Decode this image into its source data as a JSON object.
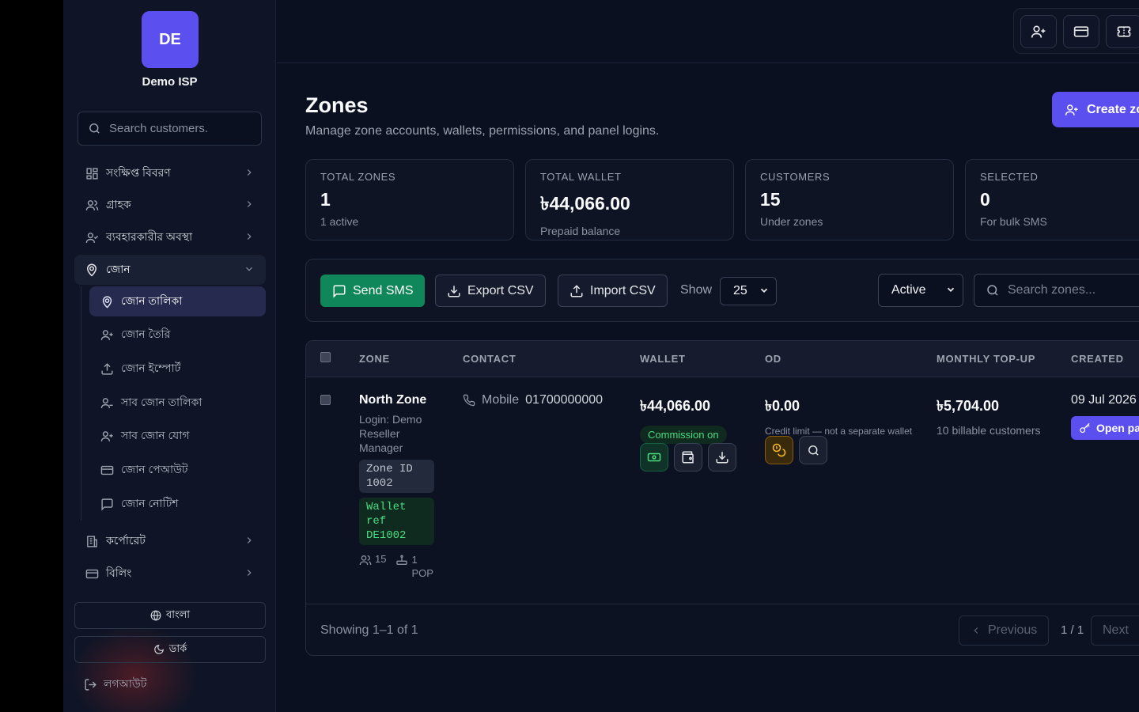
{
  "sidebar": {
    "brand_initials": "DE",
    "brand_name": "Demo ISP",
    "search_placeholder": "Search customers.",
    "nav": [
      {
        "label": "সংক্ষিপ্ত বিবরণ",
        "icon": "dashboard-icon"
      },
      {
        "label": "গ্রাহক",
        "icon": "users-icon"
      },
      {
        "label": "ব্যবহারকারীর অবস্থা",
        "icon": "user-status-icon"
      },
      {
        "label": "জোন",
        "icon": "map-pin-icon"
      }
    ],
    "sub_nav": [
      {
        "label": "জোন তালিকা",
        "icon": "map-pin-icon"
      },
      {
        "label": "জোন তৈরি",
        "icon": "user-plus-icon"
      },
      {
        "label": "জোন ইম্পোর্ট",
        "icon": "upload-icon"
      },
      {
        "label": "সাব জোন তালিকা",
        "icon": "user-icon"
      },
      {
        "label": "সাব জোন যোগ",
        "icon": "user-plus-icon"
      },
      {
        "label": "জোন পেআউট",
        "icon": "credit-card-icon"
      },
      {
        "label": "জোন নোটিশ",
        "icon": "message-icon"
      }
    ],
    "nav_bottom": [
      {
        "label": "কর্পোরেট",
        "icon": "building-icon"
      },
      {
        "label": "বিলিং",
        "icon": "credit-card-icon"
      }
    ],
    "language_button": "বাংলা",
    "theme_button": "ডার্ক",
    "logout": "লগআউট"
  },
  "page": {
    "title": "Zones",
    "subtitle": "Manage zone accounts, wallets, permissions, and panel logins.",
    "create_button": "Create zone"
  },
  "stats": [
    {
      "label": "TOTAL ZONES",
      "value": "1",
      "note": "1 active"
    },
    {
      "label": "TOTAL WALLET",
      "value": "৳44,066.00",
      "note": "Prepaid balance"
    },
    {
      "label": "CUSTOMERS",
      "value": "15",
      "note": "Under zones"
    },
    {
      "label": "SELECTED",
      "value": "0",
      "note": "For bulk SMS"
    }
  ],
  "toolbar": {
    "send_sms": "Send SMS",
    "export_csv": "Export CSV",
    "import_csv": "Import CSV",
    "show_label": "Show",
    "page_size": "25",
    "status_filter": "Active",
    "search_placeholder": "Search zones..."
  },
  "table": {
    "headers": [
      "ZONE",
      "CONTACT",
      "WALLET",
      "OD",
      "MONTHLY TOP-UP",
      "CREATED"
    ],
    "rows": [
      {
        "zone": "North Zone",
        "login": "Login: Demo Reseller Manager",
        "zone_id": "Zone ID 1002",
        "wallet_ref": "Wallet ref DE1002",
        "customers": "15",
        "pop": "1 POP",
        "contact_type": "Mobile",
        "contact_number": "01700000000",
        "wallet": "৳44,066.00",
        "commission": "Commission on",
        "od": "৳0.00",
        "od_note": "Credit limit — not a separate wallet",
        "topup": "৳5,704.00",
        "topup_note": "10 billable customers",
        "created": "09 Jul 2026",
        "open_panel": "Open panel"
      }
    ]
  },
  "footer": {
    "showing": "Showing 1–1 of 1",
    "previous": "Previous",
    "page_info": "1 / 1",
    "next": "Next"
  },
  "colors": {
    "accent": "#5b4ff0",
    "success": "#10875a",
    "background": "#0b1020"
  }
}
